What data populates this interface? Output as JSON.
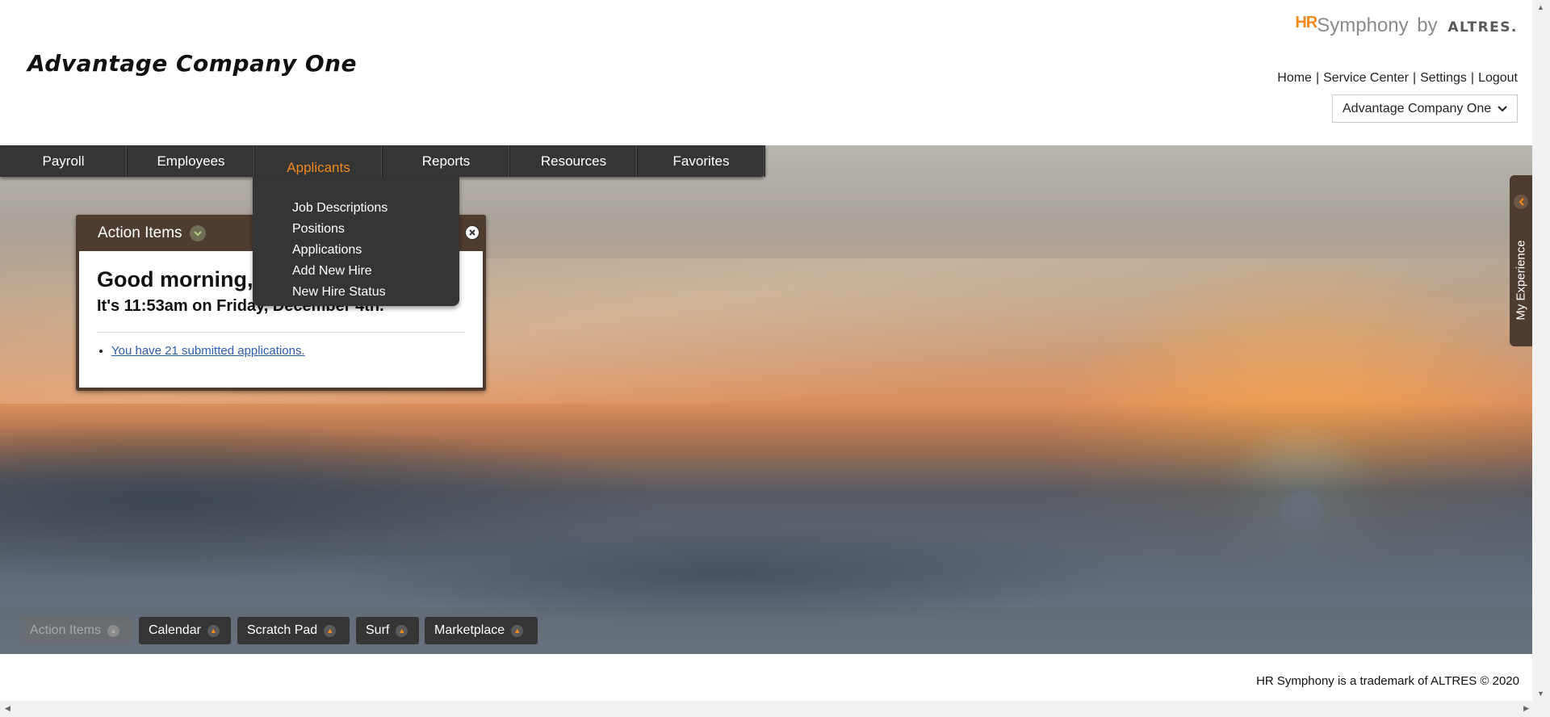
{
  "header": {
    "company_name": "Advantage Company One",
    "brand": {
      "hr": "HR",
      "symphony": "Symphony",
      "by": "by",
      "altres": "ALTRES."
    },
    "links": [
      "Home",
      "Service Center",
      "Settings",
      "Logout"
    ],
    "link_separator": "|",
    "company_select": {
      "value": "Advantage Company One",
      "icon": "chevron-down-icon"
    }
  },
  "nav": {
    "items": [
      "Payroll",
      "Employees",
      "Applicants",
      "Reports",
      "Resources",
      "Favorites"
    ],
    "active": "Applicants",
    "active_color": "#f28a1d"
  },
  "dropdown": {
    "items": [
      "Job Descriptions",
      "Positions",
      "Applications",
      "Add New Hire",
      "New Hire Status"
    ]
  },
  "action_items": {
    "title": "Action Items",
    "greeting": "Good morning,",
    "time_line": "It's 11:53am on Friday, December 4th.",
    "link": "You have 21 submitted applications."
  },
  "my_experience": {
    "label": "My Experience"
  },
  "widget_bar": {
    "tabs": [
      {
        "label": "Action Items",
        "disabled": true
      },
      {
        "label": "Calendar",
        "disabled": false
      },
      {
        "label": "Scratch Pad",
        "disabled": false
      },
      {
        "label": "Surf",
        "disabled": false
      },
      {
        "label": "Marketplace",
        "disabled": false
      }
    ]
  },
  "footer": {
    "text": "HR Symphony is a trademark of ALTRES © 2020"
  }
}
